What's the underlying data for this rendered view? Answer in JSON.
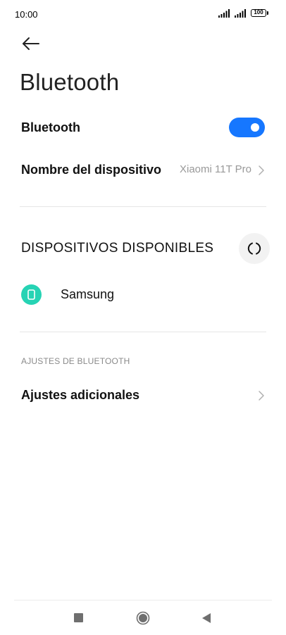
{
  "status_bar": {
    "time": "10:00",
    "battery": "100"
  },
  "header": {
    "title": "Bluetooth"
  },
  "settings": {
    "bluetooth_label": "Bluetooth",
    "bluetooth_enabled": true,
    "device_name_label": "Nombre del dispositivo",
    "device_name_value": "Xiaomi 11T Pro"
  },
  "available_devices": {
    "title": "DISPOSITIVOS DISPONIBLES",
    "items": [
      {
        "label": "Samsung",
        "icon": "phone-icon"
      }
    ]
  },
  "bluetooth_settings": {
    "title": "AJUSTES DE BLUETOOTH",
    "additional_label": "Ajustes adicionales"
  },
  "colors": {
    "accent": "#1677ff",
    "device_icon": "#26d3b4"
  },
  "icons": {
    "back": "arrow-left-icon",
    "refresh": "refresh-icon",
    "chevron": "chevron-right-icon",
    "nav_recents": "square-icon",
    "nav_home": "circle-icon",
    "nav_back": "triangle-left-icon"
  }
}
